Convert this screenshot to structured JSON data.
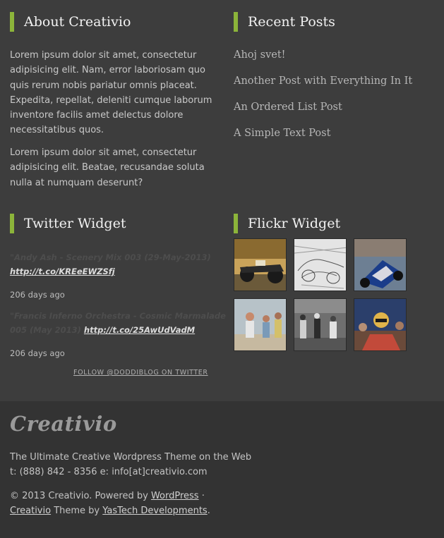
{
  "about": {
    "title": "About Creativio",
    "para1": "Lorem ipsum dolor sit amet, consectetur adipisicing elit. Nam, error laboriosam quo quis rerum nobis pariatur omnis placeat. Expedita, repellat, deleniti cumque laborum inventore facilis amet delectus dolore necessitatibus quos.",
    "para2": "Lorem ipsum dolor sit amet, consectetur adipisicing elit. Beatae, recusandae soluta nulla at numquam deserunt?"
  },
  "recent_posts": {
    "title": "Recent Posts",
    "items": [
      "Ahoj svet!",
      "Another Post with Everything In It",
      "An Ordered List Post",
      "A Simple Text Post"
    ]
  },
  "twitter": {
    "title": "Twitter Widget",
    "tweets": [
      {
        "text_line1": "\"Andy Ash - Scenery Mix 003 (29-May-2013)",
        "text_line2": "",
        "link": "http://t.co/KREeEWZSfj",
        "time": "206 days ago"
      },
      {
        "text_line1": "\"Francis Inferno Orchestra - Cosmic Marmalade",
        "text_line2": "005 (May 2013)",
        "link": "http://t.co/25AwUdVadM",
        "time": "206 days ago"
      }
    ],
    "follow": "FOLLOW @DODDIBLOG ON TWITTER"
  },
  "flickr": {
    "title": "Flickr Widget",
    "photos": [
      "race-car-photo",
      "sketch-car-photo",
      "f1-car-crowd-photo",
      "people-street-photo",
      "pit-crew-photo",
      "driver-celebration-photo"
    ]
  },
  "footer": {
    "logo": "Creativio",
    "tagline": "The Ultimate Creative Wordpress Theme on the Web",
    "contact": "t: (888) 842 - 8356 e: info[at]creativio.com",
    "copyright_prefix": "© 2013 Creativio. Powered by ",
    "wordpress_link": "WordPress",
    "copyright_sep": " ·",
    "theme_link": "Creativio",
    "theme_mid": " Theme by ",
    "author_link": "YasTech Developments",
    "end": "."
  },
  "colors": {
    "accent": "#8cb43a",
    "top_bg": "#3d3d3d",
    "footer_bg": "#333333"
  }
}
